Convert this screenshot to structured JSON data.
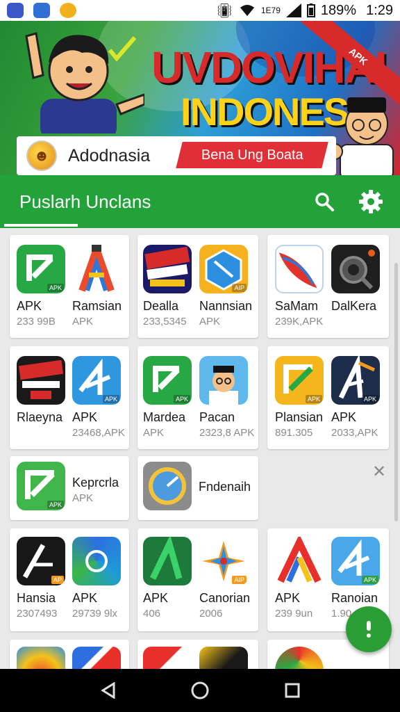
{
  "status_bar": {
    "time": "1:29",
    "battery": "189%",
    "network_small": "1E79",
    "left_apps": [
      "app-icon-a",
      "app-icon-b",
      "app-icon-c"
    ]
  },
  "banner": {
    "title_line1": "UVDOVIHALS",
    "title_line2": "INDONESIA",
    "ribbon": "APK",
    "card_title": "Adodnasia",
    "card_tagline": "Bena Ung Boata"
  },
  "header": {
    "title": "Puslarh Unclans",
    "search_icon": "search-icon",
    "settings_icon": "settings-gear-icon",
    "color": "#23a23a"
  },
  "apps": [
    {
      "name": "APK",
      "sub": "233 99B"
    },
    {
      "name": "Ramsian",
      "sub": "APK"
    },
    {
      "name": "Dealla",
      "sub": "233,5345"
    },
    {
      "name": "Nannsian",
      "sub": "APK"
    },
    {
      "name": "SaMam",
      "sub": "239K,APK"
    },
    {
      "name": "DalKera",
      "sub": ""
    },
    {
      "name": "Rlaeyna",
      "sub": ""
    },
    {
      "name": "APK",
      "sub": "23468,APK"
    },
    {
      "name": "Mardea",
      "sub": "APK"
    },
    {
      "name": "Pacan",
      "sub": "2323,8 APK"
    },
    {
      "name": "Plansian",
      "sub": "891.305"
    },
    {
      "name": "APK",
      "sub": "2033,APK"
    },
    {
      "name": "Keprcrla",
      "sub": "APK"
    },
    {
      "name": "Fndenaih",
      "sub": ""
    },
    {
      "name": "Hansia",
      "sub": "2307493"
    },
    {
      "name": "APK",
      "sub": "29739 9lx"
    },
    {
      "name": "APK",
      "sub": "406"
    },
    {
      "name": "Canorian",
      "sub": "2006"
    },
    {
      "name": "APK",
      "sub": "239 9un"
    },
    {
      "name": "Ranoian",
      "sub": "1.90"
    }
  ],
  "icon_tags": {
    "apk": "APK",
    "ap": "AP",
    "aip": "AIP"
  },
  "fab_icon": "microphone-icon",
  "nav": {
    "back": "back-icon",
    "home": "home-icon",
    "recents": "recents-icon"
  }
}
